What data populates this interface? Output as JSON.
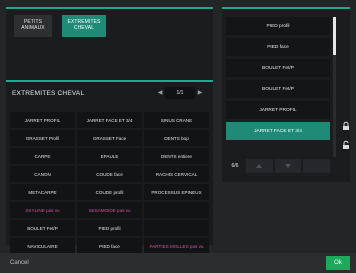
{
  "species": {
    "items": [
      {
        "label": "PETITS\nANIMAUX",
        "selected": false
      },
      {
        "label": "EXTREMITES\nCHEVAL",
        "selected": true
      }
    ]
  },
  "selection": {
    "title": "EXTREMITES CHEVAL",
    "page": "1/1",
    "cells": [
      {
        "label": "JARRET PROFIL",
        "pink": false
      },
      {
        "label": "JARRET FACE ET 3/4",
        "pink": false
      },
      {
        "label": "SINUS CRANE",
        "pink": false
      },
      {
        "label": "GRASSET Profil",
        "pink": false
      },
      {
        "label": "GRASSET Face",
        "pink": false
      },
      {
        "label": "DENTS bop",
        "pink": false
      },
      {
        "label": "CARPE",
        "pink": false
      },
      {
        "label": "EPAULE",
        "pink": false
      },
      {
        "label": "DENTS entiere",
        "pink": false
      },
      {
        "label": "CANON",
        "pink": false
      },
      {
        "label": "COUDE face",
        "pink": false
      },
      {
        "label": "RACHIS CERVICAL",
        "pink": false
      },
      {
        "label": "METACARPE",
        "pink": false
      },
      {
        "label": "COUDE profil",
        "pink": false
      },
      {
        "label": "PROCESSUS EPINEUX",
        "pink": false
      },
      {
        "label": "SKYLINE pas vu",
        "pink": true
      },
      {
        "label": "SESAMOIDE pas vu",
        "pink": true
      },
      {
        "label": "",
        "pink": false
      },
      {
        "label": "BOULET Fet/P",
        "pink": false
      },
      {
        "label": "PIED profil",
        "pink": false
      },
      {
        "label": "",
        "pink": false
      },
      {
        "label": "NAVICULAIRE",
        "pink": false
      },
      {
        "label": "PIED face",
        "pink": false
      },
      {
        "label": "PARTIES MOLLES pas vu",
        "pink": true
      }
    ]
  },
  "list": {
    "items": [
      {
        "label": "PIED profil",
        "selected": false
      },
      {
        "label": "PIED face",
        "selected": false
      },
      {
        "label": "BOULET Fet/P",
        "selected": false
      },
      {
        "label": "BOULET Fet/P",
        "selected": false
      },
      {
        "label": "JARRET PROFIL",
        "selected": false
      },
      {
        "label": "JARRET FACE ET 3/4",
        "selected": true
      }
    ],
    "count": "6/6",
    "footer_buttons": [
      "",
      "",
      ""
    ]
  },
  "footer": {
    "cancel_label": "Cancel",
    "ok_label": "Ok"
  },
  "colors": {
    "accent": "#1ea890",
    "selected": "#1f8a76",
    "pink_text": "#d94fa6",
    "ok_green": "#1ea85a"
  },
  "icons": [
    "up-icon",
    "down-icon",
    "lock-icon",
    "unlock-icon"
  ]
}
